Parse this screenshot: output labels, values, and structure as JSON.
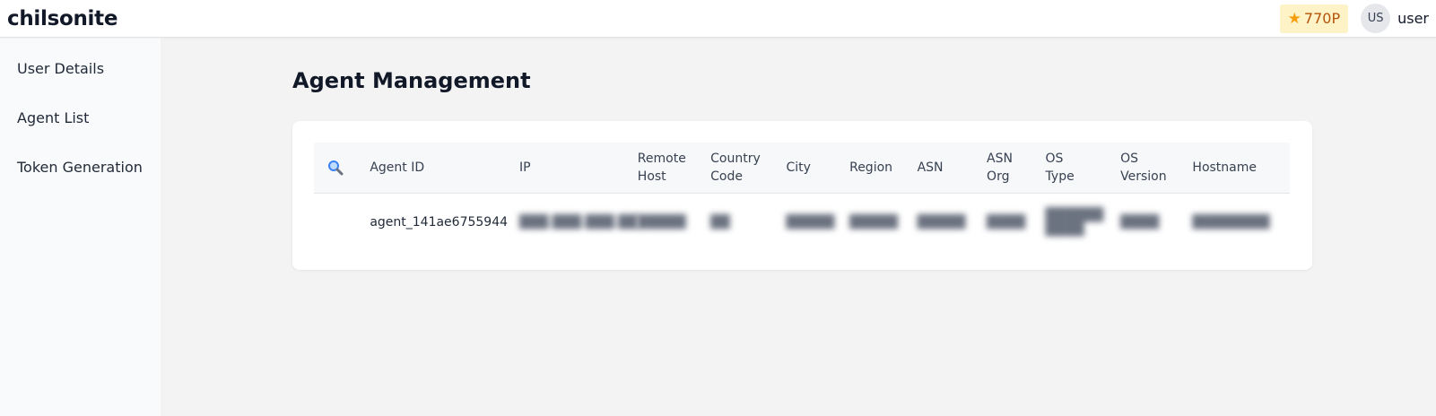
{
  "app": {
    "brand": "chilsonite",
    "points": "770P",
    "avatar_initials": "US",
    "username": "user",
    "accent_points_bg": "#fef3c7",
    "accent_points_fg": "#b45309"
  },
  "sidebar": {
    "items": [
      {
        "label": "User Details"
      },
      {
        "label": "Agent List"
      },
      {
        "label": "Token Generation"
      }
    ]
  },
  "main": {
    "title": "Agent Management"
  },
  "table": {
    "headers": {
      "agent_id": "Agent ID",
      "ip": "IP",
      "remote_host_1": "Remote",
      "remote_host_2": "Host",
      "country_code_1": "Country",
      "country_code_2": "Code",
      "city": "City",
      "region": "Region",
      "asn": "ASN",
      "asn_org_1": "ASN",
      "asn_org_2": "Org",
      "os_type_1": "OS",
      "os_type_2": "Type",
      "os_version_1": "OS",
      "os_version_2": "Version",
      "hostname": "Hostname"
    },
    "rows": [
      {
        "agent_id": "agent_141ae6755944"
      }
    ]
  },
  "icons": {
    "search": "search-icon",
    "star": "star-icon"
  }
}
